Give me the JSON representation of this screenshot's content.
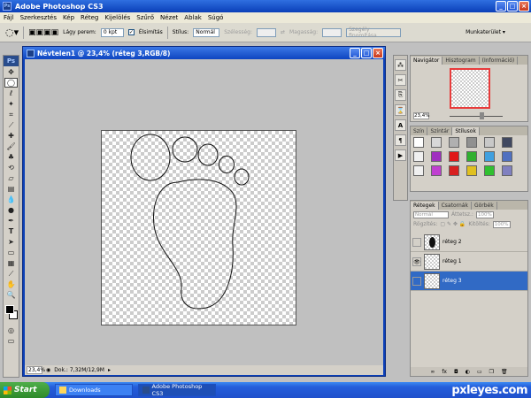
{
  "app_title": "Adobe Photoshop CS3",
  "menu": [
    "Fájl",
    "Szerkesztés",
    "Kép",
    "Réteg",
    "Kijelölés",
    "Szűrő",
    "Nézet",
    "Ablak",
    "Súgó"
  ],
  "options": {
    "feather_label": "Lágy perem:",
    "feather_value": "0 kpt",
    "antialias_label": "Élsimítás",
    "style_label": "Stílus:",
    "style_value": "Normál",
    "width_label": "Szélesség:",
    "height_label": "Magasság:",
    "refine_edge": "Szegély finomítása...",
    "workspace": "Munkaterület"
  },
  "document": {
    "title": "Névtelen1 @ 23,4% (réteg 3,RGB/8)",
    "zoom": "23,4%",
    "doc_info": "Dok.: 7,32M/12,9M"
  },
  "navigator": {
    "tabs": [
      "Navigátor",
      "Hisztogram",
      "Információ"
    ],
    "zoom": "23,4%"
  },
  "styles": {
    "tabs": [
      "Szín",
      "Színtár",
      "Stílusok"
    ],
    "swatches": [
      "#ffffff",
      "#d8d8d8",
      "#b0b0b0",
      "#909090",
      "#c8c8c8",
      "#404860",
      "#f0f0f0",
      "#a030c0",
      "#e01818",
      "#30b030",
      "#40a0e0",
      "#5070c0",
      "#f0f0f0",
      "#c040d0",
      "#d82020",
      "#e0c020",
      "#30c030",
      "#8080c0"
    ]
  },
  "layers": {
    "tabs": [
      "Rétegek",
      "Csatornák",
      "Görbék"
    ],
    "mode": "Normál",
    "opacity_label": "Áttetsz.:",
    "opacity_value": "100%",
    "lock_label": "Rögzítés:",
    "fill_label": "Kitöltés:",
    "fill_value": "100%",
    "items": [
      {
        "name": "réteg 2",
        "visible": false,
        "selected": false
      },
      {
        "name": "réteg 1",
        "visible": true,
        "selected": false
      },
      {
        "name": "réteg 3",
        "visible": false,
        "selected": true
      }
    ]
  },
  "taskbar": {
    "start": "Start",
    "tasks": [
      "Downloads",
      "Adobe Photoshop CS3"
    ]
  },
  "watermark": "pxleyes.com"
}
